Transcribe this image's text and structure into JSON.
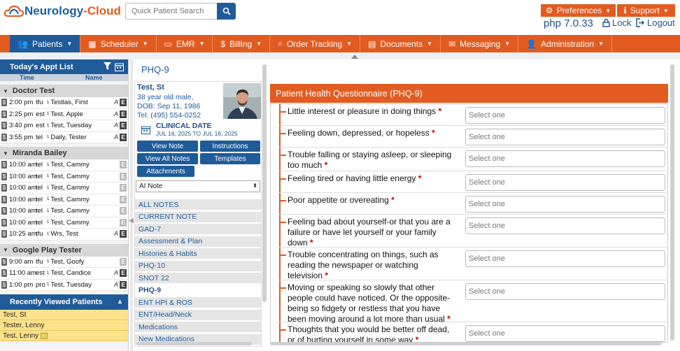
{
  "header": {
    "logo_part1": "Neurology",
    "logo_part2": "-Cloud",
    "search_placeholder": "Quick Patient Search",
    "preferences_label": "Preferences",
    "support_label": "Support",
    "php_version": "php 7.0.33",
    "lock_label": "Lock",
    "logout_label": "Logout"
  },
  "nav": [
    {
      "label": "Patients",
      "icon": "patients-icon"
    },
    {
      "label": "Scheduler",
      "icon": "scheduler-icon"
    },
    {
      "label": "EMR",
      "icon": "emr-icon"
    },
    {
      "label": "Billing",
      "icon": "billing-icon"
    },
    {
      "label": "Order Tracking",
      "icon": "search-icon"
    },
    {
      "label": "Documents",
      "icon": "documents-icon"
    },
    {
      "label": "Messaging",
      "icon": "mail-icon"
    },
    {
      "label": "Administration",
      "icon": "admin-icon"
    }
  ],
  "appt_list": {
    "title": "Today's Appt List",
    "col_time": "Time",
    "col_name": "Name",
    "groups": [
      {
        "provider": "Doctor Test",
        "items": [
          {
            "time": "2:00 pm",
            "type": "tfu",
            "name": "Testlas, First",
            "icon": "A",
            "e": "E"
          },
          {
            "time": "2:25 pm",
            "type": "est",
            "name": "Test, Apple",
            "icon": "A",
            "e": "E"
          },
          {
            "time": "3:40 pm",
            "type": "est",
            "name": "Test, Tuesday",
            "icon": "A",
            "e": "E"
          },
          {
            "time": "3:55 pm",
            "type": "tel",
            "name": "Daily, Tester",
            "icon": "A",
            "e": "E"
          }
        ]
      },
      {
        "provider": "Miranda Bailey",
        "items": [
          {
            "time": "10:00 am",
            "type": "tel",
            "name": "Test, Cammy",
            "icon": "",
            "e": "E"
          },
          {
            "time": "10:00 am",
            "type": "tel",
            "name": "Test, Cammy",
            "icon": "",
            "e": "E"
          },
          {
            "time": "10:00 am",
            "type": "tel",
            "name": "Test, Cammy",
            "icon": "",
            "e": "E"
          },
          {
            "time": "10:00 am",
            "type": "tel",
            "name": "Test, Cammy",
            "icon": "",
            "e": "E"
          },
          {
            "time": "10:00 am",
            "type": "tel",
            "name": "Test, Cammy",
            "icon": "",
            "e": "E"
          },
          {
            "time": "10:00 am",
            "type": "tel",
            "name": "Test, Cammy",
            "icon": "",
            "e": "E"
          },
          {
            "time": "10:25 am",
            "type": "tfu",
            "name": "Wrs, Test",
            "icon": "A",
            "e": "E"
          }
        ]
      },
      {
        "provider": "Google Play Tester",
        "items": [
          {
            "time": "9:00 am",
            "type": "tfu",
            "name": "Test, Goofy",
            "icon": "",
            "e": "E"
          },
          {
            "time": "11:00 am",
            "type": "est",
            "name": "Test, Candice",
            "icon": "A",
            "e": "E"
          },
          {
            "time": "1:00 pm",
            "type": "pro",
            "name": "Test, Tuesday",
            "icon": "A",
            "e": "E"
          }
        ]
      }
    ]
  },
  "recent": {
    "title": "Recently Viewed Patients",
    "items": [
      "Test, St",
      "Tester, Lenny",
      "Test, Lenny"
    ]
  },
  "middle": {
    "page_title": "PHQ-9",
    "patient_name": "Test, St",
    "patient_desc": "38 year old male,",
    "patient_dob": "DOB: Sep 11, 1986",
    "patient_tel": "Tel: (495) 554-0252",
    "clinical_label": "CLINICAL DATE",
    "clinical_range": "JUL 16, 2025 TO JUL 16, 2025",
    "btn_view_note": "View Note",
    "btn_instructions": "Instructions",
    "btn_view_all": "View All Notes",
    "btn_templates": "Templates",
    "btn_attachments": "Attachments",
    "note_select": "AI Note",
    "notes": [
      "ALL NOTES",
      "CURRENT NOTE",
      "GAD-7",
      "Assessment & Plan",
      "Histories & Habits",
      "PHQ-10",
      "SNOT 22",
      "PHQ-9",
      "ENT HPI & ROS",
      "ENT/Head/Neck",
      "Medications",
      "New Medications"
    ],
    "current_note": "PHQ-9"
  },
  "questionnaire": {
    "title": "Patient Health Questionnaire (PHQ-9)",
    "select_placeholder": "Select one",
    "questions": [
      "Little interest or pleasure in doing things",
      "Feeling down, depressed, or hopeless",
      "Trouble falling or staying asleep, or sleeping too much",
      "Feeling tired or having little energy",
      "Poor appetite or overeating",
      "Feeling bad about yourself-or that you are a failure or have let yourself or your family down",
      "Trouble concentrating on things, such as reading the newspaper or watching television",
      "Moving or speaking so slowly that other people could have noticed. Or the opposite-being so fidgety or restless that you have been moving around a lot more than usual",
      "Thoughts that you would be better off dead, or of hurting yourself in some way"
    ]
  },
  "colors": {
    "brand_orange": "#e25b20",
    "brand_blue": "#1f5b99"
  }
}
